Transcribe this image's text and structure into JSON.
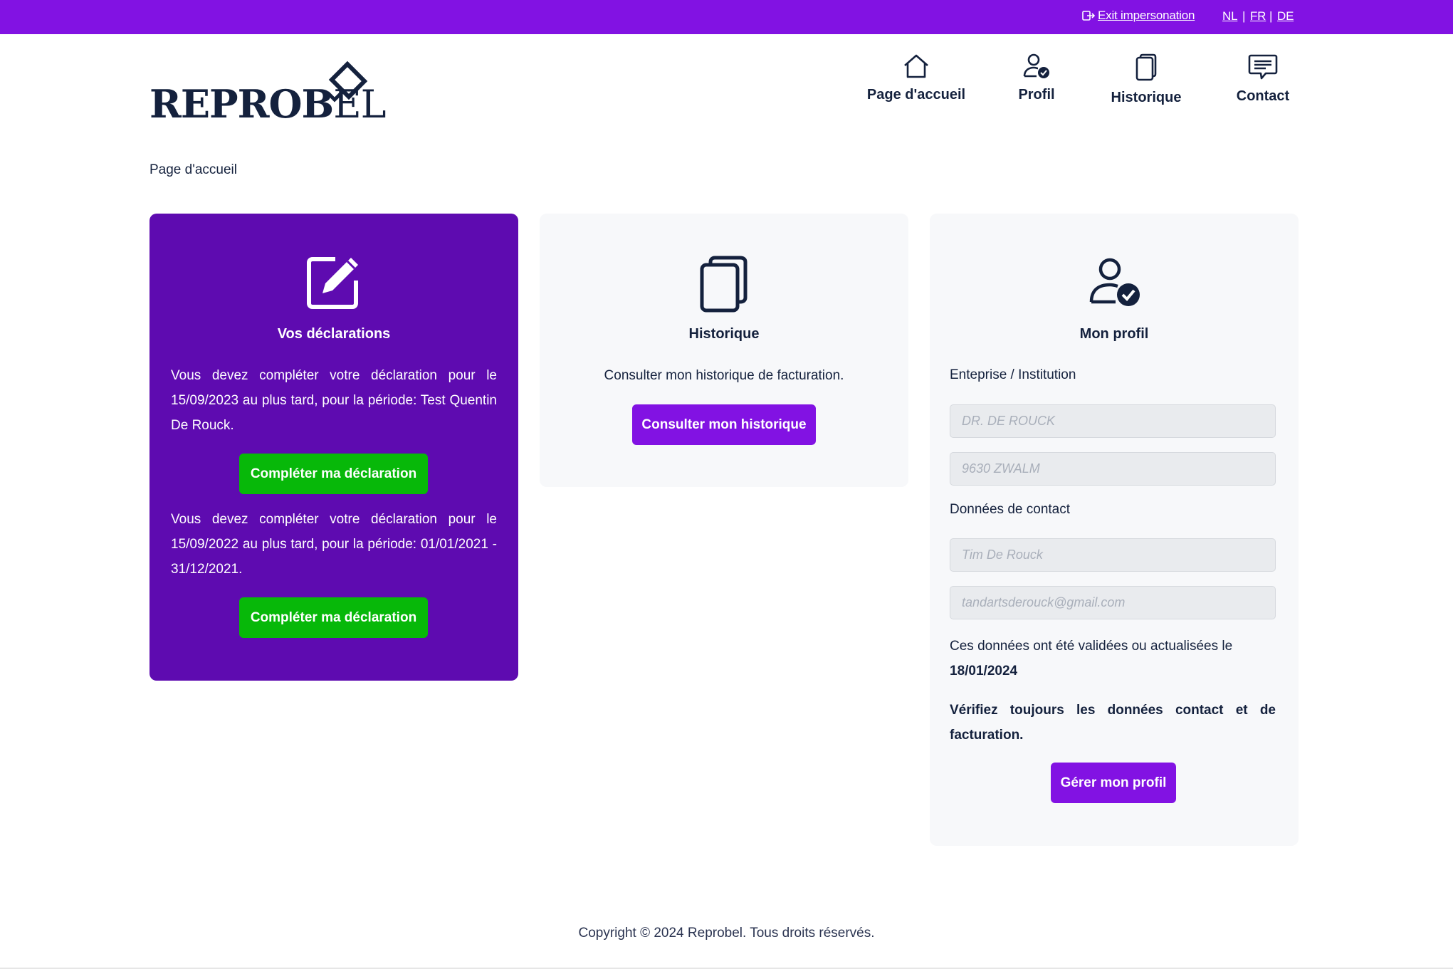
{
  "topbar": {
    "exit_label": "Exit impersonation",
    "languages": [
      "NL",
      "FR",
      "DE"
    ],
    "separator": "|",
    "background": "#8212e3"
  },
  "logo": {
    "text_bold": "REPROB",
    "text_light": "EL",
    "alt": "REPROBEL"
  },
  "nav": {
    "home": "Page d'accueil",
    "profile": "Profil",
    "history": "Historique",
    "contact": "Contact"
  },
  "breadcrumb": "Page d'accueil",
  "declarations": {
    "title": "Vos déclarations",
    "items": [
      {
        "text": "Vous devez compléter votre déclaration pour le 15/09/2023 au plus tard, pour la période: Test Quentin De Rouck.",
        "button": "Compléter ma déclaration"
      },
      {
        "text": "Vous devez compléter votre déclaration pour le 15/09/2022 au plus tard, pour la période: 01/01/2021 - 31/12/2021.",
        "button": "Compléter ma déclaration"
      }
    ],
    "background": "#5e0bb0",
    "button_color": "#07b809"
  },
  "history": {
    "title": "Historique",
    "description": "Consulter mon historique de facturation.",
    "button": "Consulter mon historique"
  },
  "profile": {
    "title": "Mon profil",
    "company_label": "Enteprise / Institution",
    "company_name": "DR. DE ROUCK",
    "company_city": "9630 ZWALM",
    "contact_label": "Données de contact",
    "contact_name": "Tim De Rouck",
    "contact_email": "tandartsderouck@gmail.com",
    "validated_text": "Ces données ont été validées ou actualisées le",
    "validated_date": "18/01/2024",
    "warning": "Vérifiez toujours les données contact et de facturation.",
    "button": "Gérer mon profil"
  },
  "footer": "Copyright © 2024 Reprobel. Tous droits réservés.",
  "colors": {
    "accent": "#8212e3",
    "navy": "#14213d",
    "card_bg": "#f7f8fa"
  }
}
